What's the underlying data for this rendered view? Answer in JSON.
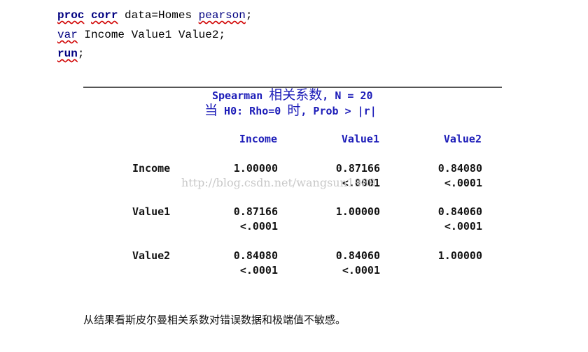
{
  "code": {
    "line1": {
      "kw1": "proc",
      "kw2": "corr",
      "rest": " data=Homes ",
      "opt": "pearson",
      "end": ";"
    },
    "line2": {
      "kw": "var",
      "rest": " Income Value1 Value2;"
    },
    "line3": {
      "kw": "run",
      "end": ";"
    }
  },
  "output": {
    "title_prefix": "Spearman ",
    "title_cjk": "相关系数",
    "title_suffix": ", N = 20",
    "subtitle_cjk1": "当",
    "subtitle_mid": " H0: Rho=0 ",
    "subtitle_cjk2": "时",
    "subtitle_suffix": ", Prob > |r|",
    "columns": [
      "Income",
      "Value1",
      "Value2"
    ],
    "rows": [
      {
        "label": "Income",
        "values": [
          "1.00000",
          "0.87166",
          "0.84080"
        ],
        "pvalues": [
          "",
          "<.0001",
          "<.0001"
        ]
      },
      {
        "label": "Value1",
        "values": [
          "0.87166",
          "1.00000",
          "0.84060"
        ],
        "pvalues": [
          "<.0001",
          "",
          "<.0001"
        ]
      },
      {
        "label": "Value2",
        "values": [
          "0.84080",
          "0.84060",
          "1.00000"
        ],
        "pvalues": [
          "<.0001",
          "<.0001",
          ""
        ]
      }
    ]
  },
  "watermark": "http://blog.csdn.net/wangsun1989",
  "note": "从结果看斯皮尔曼相关系数对错误数据和极端值不敏感。",
  "colors": {
    "header_blue": "#1c1cb8",
    "code_keyword": "#000080",
    "spellcheck_underline": "#d00000",
    "rule": "#555555"
  }
}
